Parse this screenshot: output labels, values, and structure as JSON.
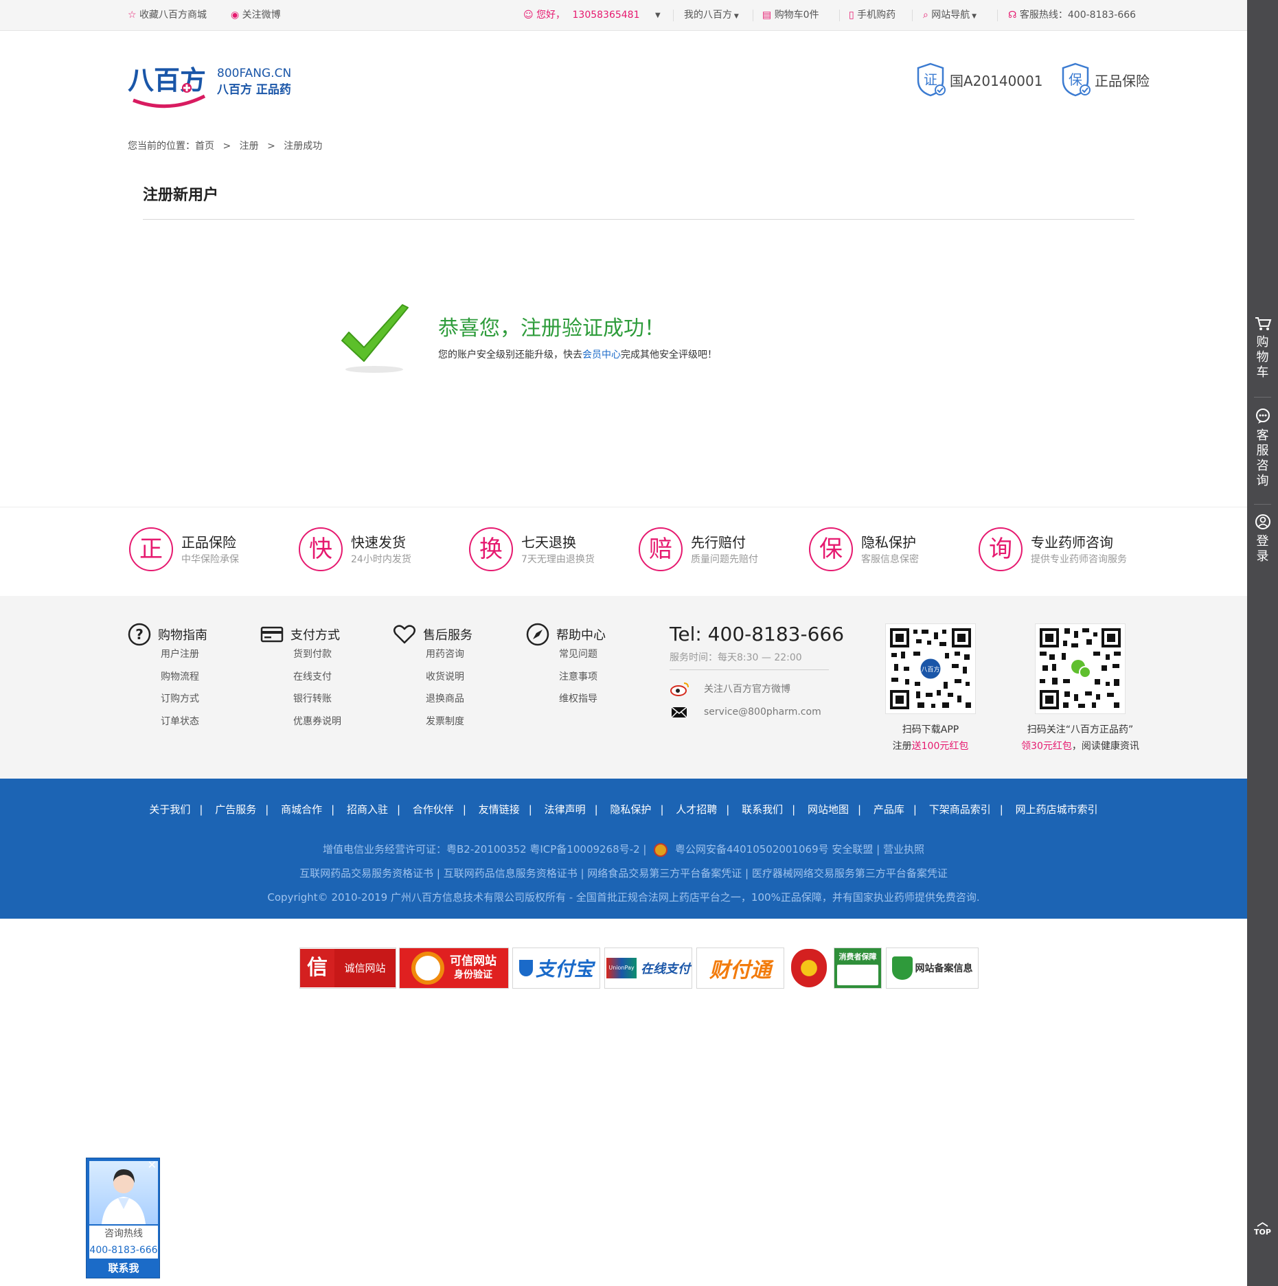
{
  "topbar": {
    "favorite": "收藏八百方商城",
    "follow_weibo": "关注微博",
    "greeting": "您好，",
    "phone": "13058365481",
    "my_account": "我的八百方",
    "cart": "购物车0件",
    "mobile": "手机购药",
    "site_nav": "网站导航",
    "hotline": "客服热线：400-8183-666"
  },
  "header": {
    "logo_main": "八百方",
    "logo_domain": "800FANG.CN",
    "logo_tag": "八百方 正品药",
    "badge1_icon_text": "证",
    "badge1": "国A20140001",
    "badge2_icon_text": "保",
    "badge2": "正品保险"
  },
  "breadcrumb": {
    "prefix": "您当前的位置：",
    "home": "首页",
    "sep": ">",
    "register": "注册",
    "current": "注册成功"
  },
  "page_title": "注册新用户",
  "success": {
    "title": "恭喜您，注册验证成功！",
    "desc_before": "您的账户安全级别还能升级，快去",
    "desc_link": "会员中心",
    "desc_after": "完成其他安全评级吧！"
  },
  "services": [
    {
      "icon": "正",
      "name": "正品保险",
      "sub": "中华保险承保"
    },
    {
      "icon": "快",
      "name": "快速发货",
      "sub": "24小时内发货"
    },
    {
      "icon": "换",
      "name": "七天退换",
      "sub": "7天无理由退换货"
    },
    {
      "icon": "赔",
      "name": "先行赔付",
      "sub": "质量问题先赔付"
    },
    {
      "icon": "保",
      "name": "隐私保护",
      "sub": "客服信息保密"
    },
    {
      "icon": "询",
      "name": "专业药师咨询",
      "sub": "提供专业药师咨询服务"
    }
  ],
  "footer_cols": [
    {
      "title": "购物指南",
      "icon": "question-icon",
      "links": [
        "用户注册",
        "购物流程",
        "订购方式",
        "订单状态"
      ]
    },
    {
      "title": "支付方式",
      "icon": "card-icon",
      "links": [
        "货到付款",
        "在线支付",
        "银行转账",
        "优惠券说明"
      ]
    },
    {
      "title": "售后服务",
      "icon": "heart-icon",
      "links": [
        "用药咨询",
        "收货说明",
        "退换商品",
        "发票制度"
      ]
    },
    {
      "title": "帮助中心",
      "icon": "compass-icon",
      "links": [
        "常见问题",
        "注意事项",
        "维权指导"
      ]
    }
  ],
  "contact": {
    "tel": "Tel: 400-8183-666",
    "hours": "服务时间：每天8:30 — 22:00",
    "weibo": "关注八百方官方微博",
    "email": "service@800pharm.com"
  },
  "qr": {
    "app_line1": "扫码下载APP",
    "app_line2_a": "注册",
    "app_line2_b": "送100元红包",
    "wx_line1": "扫码关注“八百方正品药”",
    "wx_line2_a": "领30元红包",
    "wx_line2_b": "，阅读健康资讯"
  },
  "footer_links": [
    "关于我们",
    "广告服务",
    "商城合作",
    "招商入驻",
    "合作伙伴",
    "友情链接",
    "法律声明",
    "隐私保护",
    "人才招聘",
    "联系我们",
    "网站地图",
    "产品库",
    "下架商品索引",
    "网上药店城市索引"
  ],
  "license": {
    "line1_a": "增值电信业务经营许可证：粤B2-20100352   粤ICP备10009268号-2 |",
    "line1_b": "粤公网安备44010502001069号   安全联盟 |  营业执照",
    "line2": "互联网药品交易服务资格证书 |  互联网药品信息服务资格证书 |  网络食品交易第三方平台备案凭证 |  医疗器械网络交易服务第三方平台备案凭证",
    "line3": "Copyright© 2010-2019 广州八百方信息技术有限公司版权所有 - 全国首批正规合法网上药店平台之一，100%正品保障，并有国家执业药师提供免费咨询."
  },
  "trust": {
    "t1": "诚信网站",
    "t2a": "可信网站",
    "t2b": "身份验证",
    "t3": "支付宝",
    "t4a": "UnionPay",
    "t4b": "在线支付",
    "t5": "财付通",
    "t7": "消费者保障",
    "t8": "网站备案信息"
  },
  "sidebar": {
    "cart": "购物车",
    "service": "客服咨询",
    "login": "登录",
    "top": "TOP"
  },
  "consult": {
    "label1": "咨询热线",
    "label2": "400-8183-666",
    "label3": "联系我"
  },
  "colors": {
    "brand_pink": "#e6196f",
    "footer_blue": "#1c64b4",
    "success_green": "#2e9c3b",
    "sidebar": "#4a4a4d"
  }
}
